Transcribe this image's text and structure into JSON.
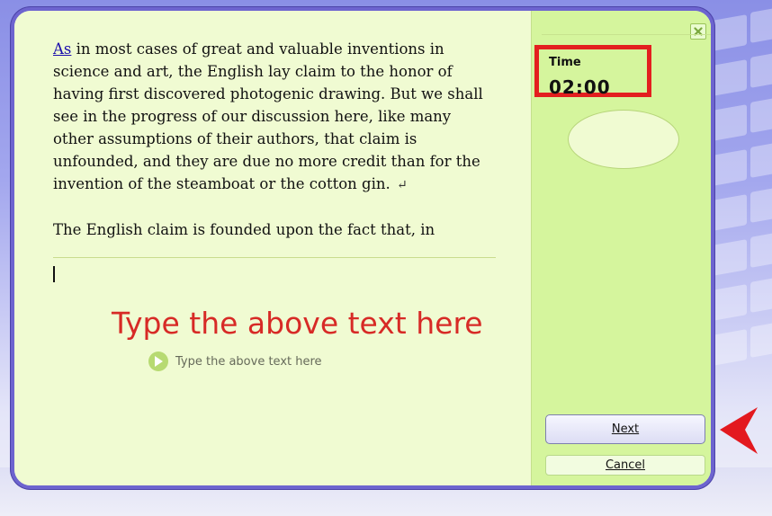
{
  "passage": {
    "first_word": "As",
    "paragraph1": " in most cases of great and valuable inventions in science and art, the English lay claim to the honor of having first discovered photogenic drawing. But we shall see in the progress of our discussion here, like many other assumptions of their authors, that claim is unfounded, and they are due no more credit than for the invention of the steamboat or the cotton gin.",
    "return_symbol": "↵",
    "paragraph2": "The English claim is founded upon the fact that, in"
  },
  "input_area": {
    "annotation": "Type the above text here",
    "hint_label": "Type the above text here"
  },
  "timer": {
    "label": "Time",
    "value": "02:00"
  },
  "buttons": {
    "next": "Next",
    "cancel": "Cancel"
  },
  "icons": {
    "close": "close-icon",
    "play": "play-icon",
    "arrow": "red-arrow-pointer"
  },
  "colors": {
    "accent_red": "#e31f1f",
    "frame": "#6d64cf",
    "pane_left": "#f0fbd2",
    "pane_right": "#d5f59d"
  }
}
